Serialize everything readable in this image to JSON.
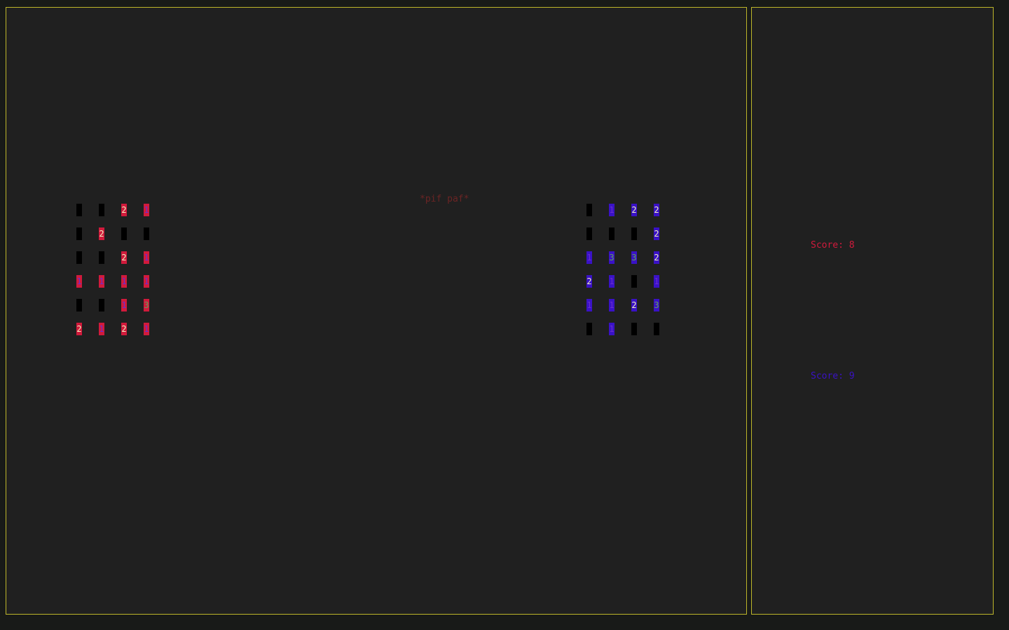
{
  "effect_text": "*pif paf*",
  "colors": {
    "border": "#bdb62a",
    "panel_bg": "#202020",
    "empty_cell": "#000000",
    "red_cell": "#d11a3c",
    "blue_cell": "#3a12c6",
    "value_text": {
      "1": "#6a2dd0",
      "2": "#f2eec0",
      "3": "#5fa15a"
    }
  },
  "boards": {
    "red": {
      "cells": [
        [
          "",
          "",
          "2",
          "1"
        ],
        [
          "",
          "2",
          "",
          ""
        ],
        [
          "",
          "",
          "2",
          "1"
        ],
        [
          "1",
          "1",
          "1",
          "1"
        ],
        [
          "",
          "",
          "1",
          "3"
        ],
        [
          "2",
          "1",
          "2",
          "1"
        ]
      ]
    },
    "blue": {
      "cells": [
        [
          "",
          "1",
          "2",
          "2"
        ],
        [
          "",
          "",
          "",
          "2"
        ],
        [
          "1",
          "3",
          "3",
          "2"
        ],
        [
          "2",
          "1",
          "",
          "1"
        ],
        [
          "1",
          "1",
          "2",
          "3"
        ],
        [
          "",
          "1",
          "",
          ""
        ]
      ]
    }
  },
  "scores": {
    "red": {
      "label": "Score: ",
      "value": "8"
    },
    "blue": {
      "label": "Score: ",
      "value": "9"
    }
  }
}
